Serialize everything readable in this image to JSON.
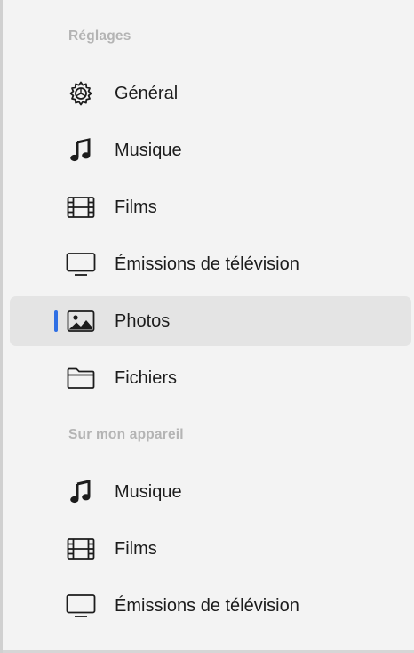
{
  "sidebar": {
    "sections": [
      {
        "header": "Réglages",
        "items": [
          {
            "label": "Général",
            "icon": "gear-icon"
          },
          {
            "label": "Musique",
            "icon": "music-note-icon"
          },
          {
            "label": "Films",
            "icon": "film-icon"
          },
          {
            "label": "Émissions de télévision",
            "icon": "tv-icon"
          },
          {
            "label": "Photos",
            "icon": "photo-icon",
            "selected": true
          },
          {
            "label": "Fichiers",
            "icon": "folder-icon"
          }
        ]
      },
      {
        "header": "Sur mon appareil",
        "items": [
          {
            "label": "Musique",
            "icon": "music-note-icon"
          },
          {
            "label": "Films",
            "icon": "film-icon"
          },
          {
            "label": "Émissions de télévision",
            "icon": "tv-icon"
          }
        ]
      }
    ]
  },
  "colors": {
    "background": "#f3f3f3",
    "selected_background": "#e4e4e4",
    "selection_indicator": "#2f6fe4",
    "header_text": "#b4b4b4"
  }
}
